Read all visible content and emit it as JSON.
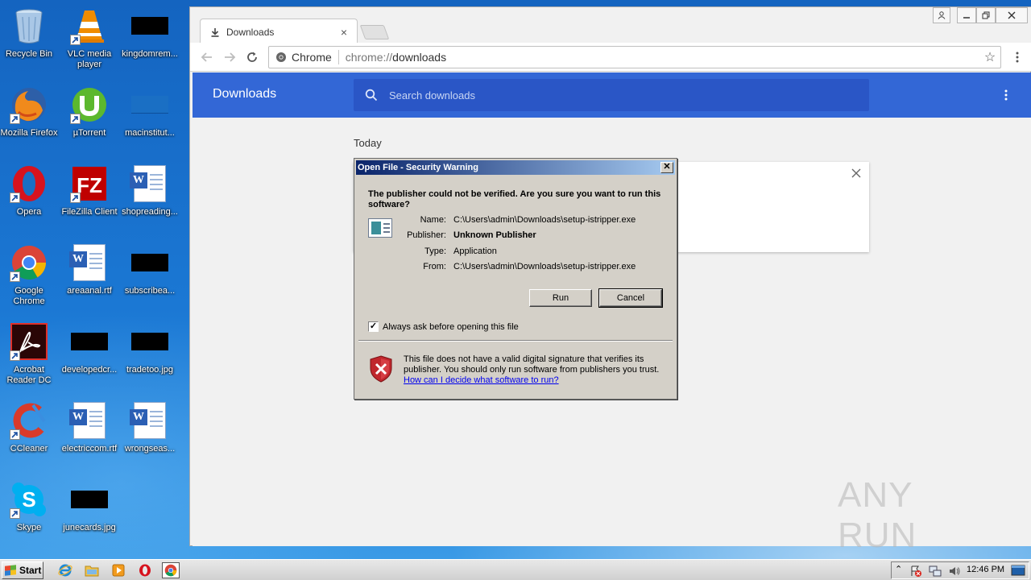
{
  "desktop": {
    "icons": [
      {
        "label": "Recycle Bin",
        "icon": "recycle-bin-icon"
      },
      {
        "label": "VLC media player",
        "icon": "vlc-icon"
      },
      {
        "label": "kingdomrem...",
        "icon": "redacted-image-icon"
      },
      {
        "label": "Mozilla Firefox",
        "icon": "firefox-icon"
      },
      {
        "label": "µTorrent",
        "icon": "utorrent-icon"
      },
      {
        "label": "macinstitut...",
        "icon": "blank-file-icon"
      },
      {
        "label": "Opera",
        "icon": "opera-icon"
      },
      {
        "label": "FileZilla Client",
        "icon": "filezilla-icon"
      },
      {
        "label": "shopreading...",
        "icon": "word-doc-icon"
      },
      {
        "label": "Google Chrome",
        "icon": "chrome-icon"
      },
      {
        "label": "areaanal.rtf",
        "icon": "word-doc-icon"
      },
      {
        "label": "subscribea...",
        "icon": "redacted-image-icon"
      },
      {
        "label": "Acrobat Reader DC",
        "icon": "acrobat-icon"
      },
      {
        "label": "developedcr...",
        "icon": "redacted-image-icon"
      },
      {
        "label": "tradetoo.jpg",
        "icon": "redacted-image-icon"
      },
      {
        "label": "CCleaner",
        "icon": "ccleaner-icon"
      },
      {
        "label": "electriccom.rtf",
        "icon": "word-doc-icon"
      },
      {
        "label": "wrongseas...",
        "icon": "word-doc-icon"
      },
      {
        "label": "Skype",
        "icon": "skype-icon"
      },
      {
        "label": "junecards.jpg",
        "icon": "redacted-image-icon"
      }
    ]
  },
  "browser": {
    "tab_title": "Downloads",
    "tab_close": "×",
    "omnibox": {
      "origin_label": "Chrome",
      "url_scheme": "chrome://",
      "url_path": "downloads"
    },
    "downloads": {
      "title": "Downloads",
      "search_placeholder": "Search downloads",
      "section_today": "Today"
    }
  },
  "dialog": {
    "title": "Open File - Security Warning",
    "close_glyph": "✕",
    "question": "The publisher could not be verified.  Are you sure you want to run this software?",
    "fields": [
      {
        "key": "Name:",
        "value": "C:\\Users\\admin\\Downloads\\setup-istripper.exe",
        "bold": false
      },
      {
        "key": "Publisher:",
        "value": "Unknown Publisher",
        "bold": true
      },
      {
        "key": "Type:",
        "value": "Application",
        "bold": false
      },
      {
        "key": "From:",
        "value": "C:\\Users\\admin\\Downloads\\setup-istripper.exe",
        "bold": false
      }
    ],
    "run_label": "Run",
    "cancel_label": "Cancel",
    "checkbox_label": "Always ask before opening this file",
    "checkbox_checked": true,
    "warning_text": "This file does not have a valid digital signature that verifies its publisher.  You should only run software from publishers you trust.",
    "help_link": "How can I decide what software to run?"
  },
  "taskbar": {
    "start_label": "Start",
    "clock": "12:46 PM",
    "pinned": [
      "internet-explorer-icon",
      "explorer-folder-icon",
      "media-player-icon",
      "opera-icon",
      "chrome-icon"
    ]
  },
  "watermark": {
    "text": "ANY RUN"
  },
  "colors": {
    "chrome_blue": "#3367d6",
    "search_blue": "#2a56c6",
    "dialog_bg": "#d4d0c8",
    "titlebar_start": "#0a246a",
    "titlebar_end": "#a6caf0",
    "link": "#0000ee"
  }
}
